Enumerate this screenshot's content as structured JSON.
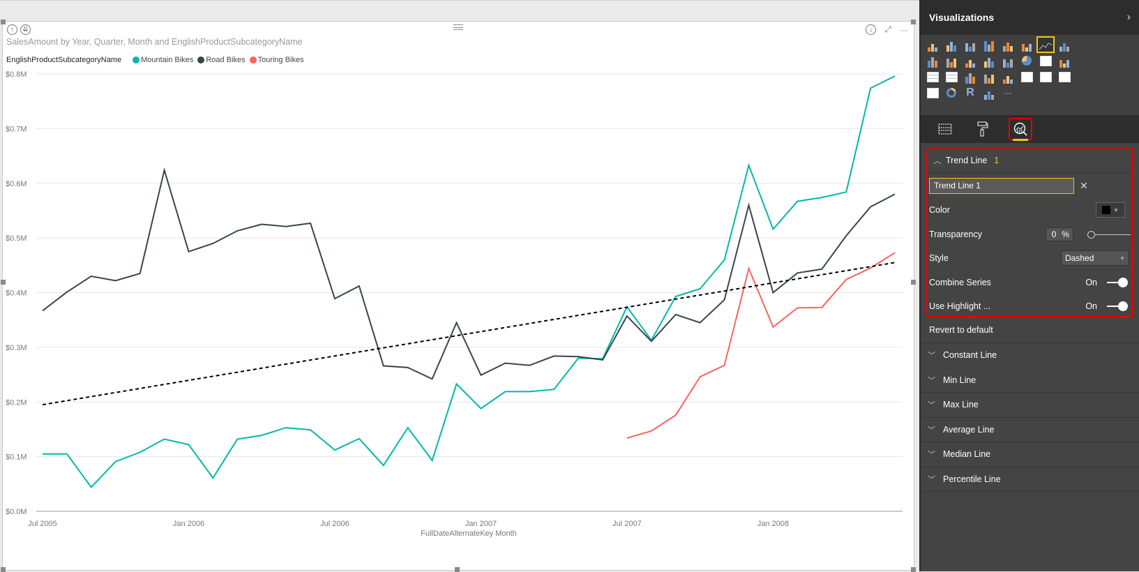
{
  "visual": {
    "title": "SalesAmount by Year, Quarter, Month and EnglishProductSubcategoryName",
    "drill_up_icon": "drill-up-icon",
    "drill_down_icon": "drill-down-all-icon",
    "download_icon": "drill-down-icon",
    "focus_icon": "focus-mode-icon",
    "more_icon": "more-options-icon",
    "more_label": "···"
  },
  "chart_data": {
    "type": "line",
    "title": "SalesAmount by Year, Quarter, Month and EnglishProductSubcategoryName",
    "xlabel": "FullDateAlternateKey Month",
    "ylabel": "",
    "legend_title": "EnglishProductSubcategoryName",
    "legend_position": "top-left",
    "ylim": [
      0,
      0.8
    ],
    "yunit": "$M",
    "yticks": [
      "$0.0M",
      "$0.1M",
      "$0.2M",
      "$0.3M",
      "$0.4M",
      "$0.5M",
      "$0.6M",
      "$0.7M",
      "$0.8M"
    ],
    "x": [
      "Jul 2005",
      "Aug 2005",
      "Sep 2005",
      "Oct 2005",
      "Nov 2005",
      "Dec 2005",
      "Jan 2006",
      "Feb 2006",
      "Mar 2006",
      "Apr 2006",
      "May 2006",
      "Jun 2006",
      "Jul 2006",
      "Aug 2006",
      "Sep 2006",
      "Oct 2006",
      "Nov 2006",
      "Dec 2006",
      "Jan 2007",
      "Feb 2007",
      "Mar 2007",
      "Apr 2007",
      "May 2007",
      "Jun 2007",
      "Jul 2007",
      "Aug 2007",
      "Sep 2007",
      "Oct 2007",
      "Nov 2007",
      "Dec 2007",
      "Jan 2008",
      "Feb 2008",
      "Mar 2008",
      "Apr 2008",
      "May 2008",
      "Jun 2008"
    ],
    "xticks": [
      "Jul 2005",
      "Jan 2006",
      "Jul 2006",
      "Jan 2007",
      "Jul 2007",
      "Jan 2008"
    ],
    "grid": true,
    "series": [
      {
        "name": "Mountain Bikes",
        "color": "#01B8AA",
        "values": [
          0.105,
          0.105,
          0.044,
          0.091,
          0.108,
          0.132,
          0.122,
          0.061,
          0.132,
          0.139,
          0.153,
          0.149,
          0.112,
          0.133,
          0.084,
          0.153,
          0.093,
          0.233,
          0.188,
          0.219,
          0.219,
          0.223,
          0.28,
          0.279,
          0.374,
          0.313,
          0.393,
          0.407,
          0.46,
          0.633,
          0.516,
          0.567,
          0.574,
          0.584,
          0.774,
          0.796
        ]
      },
      {
        "name": "Road Bikes",
        "color": "#374649",
        "values": [
          0.367,
          0.401,
          0.43,
          0.422,
          0.435,
          0.624,
          0.475,
          0.49,
          0.513,
          0.525,
          0.521,
          0.527,
          0.389,
          0.412,
          0.266,
          0.263,
          0.242,
          0.345,
          0.249,
          0.271,
          0.267,
          0.284,
          0.283,
          0.277,
          0.357,
          0.311,
          0.36,
          0.345,
          0.387,
          0.56,
          0.4,
          0.436,
          0.443,
          0.504,
          0.557,
          0.58
        ]
      },
      {
        "name": "Touring Bikes",
        "color": "#FD625E",
        "values": [
          null,
          null,
          null,
          null,
          null,
          null,
          null,
          null,
          null,
          null,
          null,
          null,
          null,
          null,
          null,
          null,
          null,
          null,
          null,
          null,
          null,
          null,
          null,
          null,
          0.134,
          0.147,
          0.176,
          0.246,
          0.267,
          0.444,
          0.337,
          0.372,
          0.373,
          0.424,
          0.445,
          0.473
        ]
      }
    ],
    "trend_line": {
      "name": "Trend Line 1",
      "style": "dashed",
      "color": "#000000",
      "start_value": 0.195,
      "end_value": 0.455
    }
  },
  "panel": {
    "title": "Visualizations",
    "collapse_icon": "chevron-right-icon",
    "viz_types": [
      "stacked-bar",
      "stacked-column",
      "clustered-bar",
      "clustered-column",
      "100-stacked-bar",
      "100-stacked-column",
      "line",
      "area",
      "stacked-area",
      "line-and-stacked-column",
      "line-and-clustered-column",
      "ribbon",
      "scatter",
      "pie",
      "treemap",
      "map",
      "table",
      "matrix",
      "filled-map",
      "funnel",
      "gauge",
      "multi-row-card",
      "card",
      "kpi",
      "slicer",
      "donut",
      "r-script",
      "shape-map",
      "more"
    ],
    "selected_viz": "line",
    "tabs": [
      {
        "name": "fields",
        "icon": "fields-icon"
      },
      {
        "name": "format",
        "icon": "paint-roller-icon"
      },
      {
        "name": "analytics",
        "icon": "analytics-icon",
        "active": true
      }
    ],
    "trend": {
      "label": "Trend Line",
      "count": "1",
      "name_value": "Trend Line 1",
      "color_label": "Color",
      "color_value": "#000000",
      "transparency_label": "Transparency",
      "transparency_value": "0",
      "transparency_unit": "%",
      "style_label": "Style",
      "style_value": "Dashed",
      "combine_label": "Combine Series",
      "combine_value": "On",
      "highlight_label": "Use Highlight ...",
      "highlight_value": "On"
    },
    "revert_label": "Revert to default",
    "sections": [
      "Constant Line",
      "Min Line",
      "Max Line",
      "Average Line",
      "Median Line",
      "Percentile Line"
    ]
  }
}
